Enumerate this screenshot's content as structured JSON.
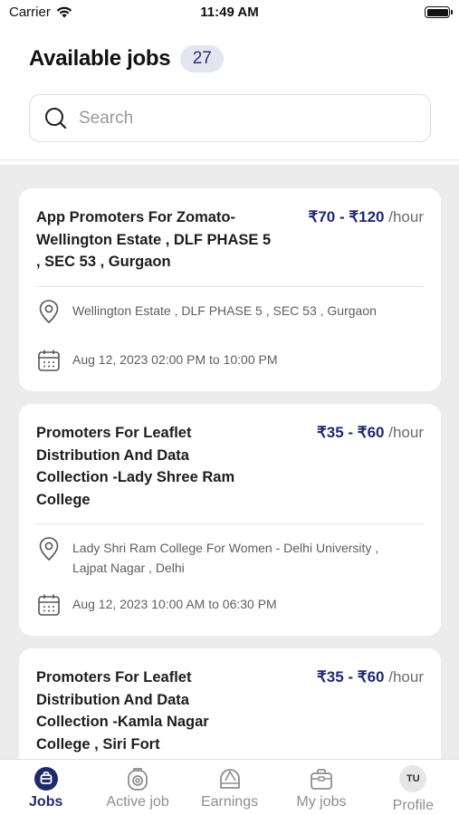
{
  "status_bar": {
    "carrier": "Carrier",
    "time": "11:49 AM"
  },
  "header": {
    "title": "Available jobs",
    "count": "27"
  },
  "search": {
    "placeholder": "Search"
  },
  "jobs": [
    {
      "title": "App Promoters For Zomato-Wellington Estate , DLF PHASE 5 , SEC 53 , Gurgaon",
      "rate": "₹70 - ₹120",
      "unit": " /hour",
      "location": "Wellington Estate , DLF PHASE 5 , SEC 53 , Gurgaon",
      "datetime": "Aug 12, 2023 02:00 PM to 10:00 PM"
    },
    {
      "title": "Promoters For Leaflet Distribution And Data Collection -Lady Shree Ram College",
      "rate": "₹35 - ₹60",
      "unit": " /hour",
      "location": "Lady Shri Ram College For Women - Delhi University , Lajpat Nagar , Delhi",
      "datetime": "Aug 12, 2023 10:00 AM to 06:30 PM"
    },
    {
      "title": "Promoters For Leaflet Distribution And Data Collection -Kamla Nagar College , Siri Fort",
      "rate": "₹35 - ₹60",
      "unit": " /hour"
    }
  ],
  "tabs": [
    {
      "label": "Jobs",
      "icon": "jobs-icon"
    },
    {
      "label": "Active job",
      "icon": "active-job-icon"
    },
    {
      "label": "Earnings",
      "icon": "earnings-icon"
    },
    {
      "label": "My jobs",
      "icon": "briefcase-icon"
    },
    {
      "label": "Profile",
      "icon": "avatar",
      "initials": "TU"
    }
  ],
  "colors": {
    "accent": "#1f2a6b",
    "list_bg": "#ececec",
    "badge_bg": "#e3e6f0"
  }
}
